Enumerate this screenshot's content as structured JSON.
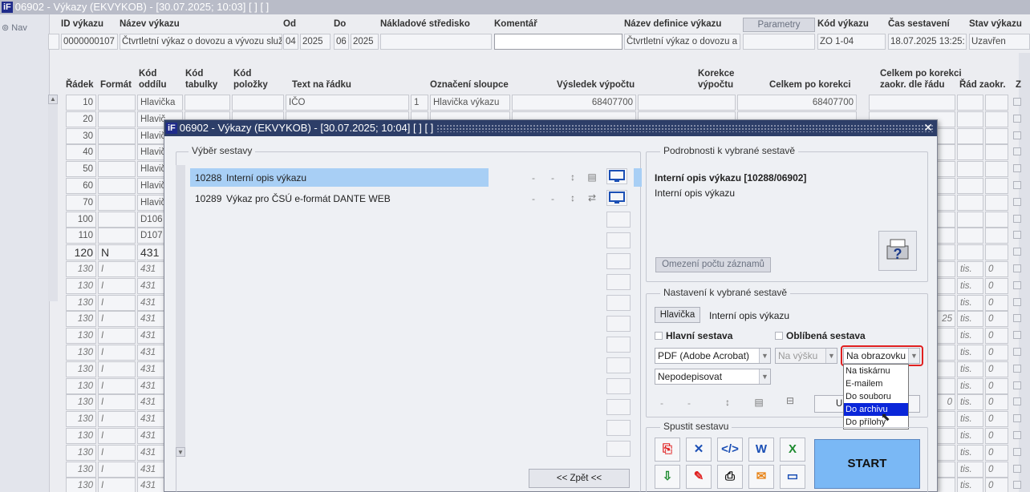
{
  "window": {
    "title": "06902 - Výkazy (EKVYKOB) - [30.07.2025; 10:03]  [ ]  [ ]",
    "logo": "iF"
  },
  "nav": {
    "label": "Nav"
  },
  "header": {
    "labels": {
      "id": "ID výkazu",
      "name": "Název výkazu",
      "od": "Od",
      "do": "Do",
      "center": "Nákladové středisko",
      "comment": "Komentář",
      "defname": "Název definice výkazu",
      "params": "Parametry",
      "code": "Kód výkazu",
      "time": "Čas sestavení",
      "state": "Stav výkazu"
    },
    "values": {
      "id": "0000000107",
      "name": "Čtvrtletní výkaz o dovozu a vývozu služe",
      "od_m": "04",
      "od_y": "2025",
      "do_m": "06",
      "do_y": "2025",
      "center": "",
      "comment": "",
      "defname": "Čtvrtletní výkaz o dovozu a v",
      "params_val": "",
      "code": "ZO 1-04",
      "time": "18.07.2025 13:25:",
      "state": "Uzavřen"
    }
  },
  "table": {
    "headers": {
      "radek": "Řádek",
      "format": "Formát",
      "kod_oddilu_1": "Kód",
      "kod_oddilu_2": "oddílu",
      "kod_tabulky_1": "Kód",
      "kod_tabulky_2": "tabulky",
      "kod_polozky_1": "Kód",
      "kod_polozky_2": "položky",
      "text": "Text na řádku",
      "ozn": "Označení sloupce",
      "vysledek": "Výsledek výpočtu",
      "korekce_1": "Korekce",
      "korekce_2": "výpočtu",
      "celkem": "Celkem po korekci",
      "celkem_zaokr_1": "Celkem po korekci",
      "celkem_zaokr_2": "zaokr. dle řádu",
      "rad": "Řád zaokr.",
      "z": "Z"
    },
    "rows": [
      {
        "radek": "10",
        "format": "",
        "oddil": "Hlavička",
        "text": "IČO",
        "col": "1",
        "ozn": "Hlavička výkazu",
        "vysledek": "68407700",
        "celkem": "68407700"
      },
      {
        "radek": "20",
        "format": "",
        "oddil": "Hlavič",
        "text": "",
        "col": "",
        "ozn": ""
      },
      {
        "radek": "30",
        "format": "",
        "oddil": "Hlavič"
      },
      {
        "radek": "40",
        "format": "",
        "oddil": "Hlavič"
      },
      {
        "radek": "50",
        "format": "",
        "oddil": "Hlavič"
      },
      {
        "radek": "60",
        "format": "",
        "oddil": "Hlavič"
      },
      {
        "radek": "70",
        "format": "",
        "oddil": "Hlavič"
      },
      {
        "radek": "100",
        "format": "",
        "oddil": "D106"
      },
      {
        "radek": "110",
        "format": "",
        "oddil": "D107"
      },
      {
        "radek": "120",
        "format": "N",
        "oddil": "431"
      },
      {
        "radek": "130",
        "format": "I",
        "oddil": "431",
        "rad": "tis.",
        "zaokr": "0"
      },
      {
        "radek": "130",
        "format": "I",
        "oddil": "431",
        "rad": "tis.",
        "zaokr": "0"
      },
      {
        "radek": "130",
        "format": "I",
        "oddil": "431",
        "rad": "tis.",
        "zaokr": "0"
      },
      {
        "radek": "130",
        "format": "I",
        "oddil": "431",
        "rad": "tis.",
        "zaokr": "0",
        "celkem_zaokr": "25"
      },
      {
        "radek": "130",
        "format": "I",
        "oddil": "431",
        "rad": "tis.",
        "zaokr": "0"
      },
      {
        "radek": "130",
        "format": "I",
        "oddil": "431",
        "rad": "tis.",
        "zaokr": "0"
      },
      {
        "radek": "130",
        "format": "I",
        "oddil": "431",
        "rad": "tis.",
        "zaokr": "0"
      },
      {
        "radek": "130",
        "format": "I",
        "oddil": "431",
        "rad": "tis.",
        "zaokr": "0"
      },
      {
        "radek": "130",
        "format": "I",
        "oddil": "431",
        "rad": "tis.",
        "zaokr": "0",
        "celkem_zaokr": "0"
      },
      {
        "radek": "130",
        "format": "I",
        "oddil": "431",
        "rad": "tis.",
        "zaokr": "0"
      },
      {
        "radek": "130",
        "format": "I",
        "oddil": "431",
        "rad": "tis.",
        "zaokr": "0"
      },
      {
        "radek": "130",
        "format": "I",
        "oddil": "431",
        "rad": "tis.",
        "zaokr": "0"
      },
      {
        "radek": "130",
        "format": "I",
        "oddil": "431",
        "rad": "tis.",
        "zaokr": "0"
      },
      {
        "radek": "130",
        "format": "I",
        "oddil": "431",
        "rad": "tis.",
        "zaokr": "0"
      }
    ]
  },
  "dialog": {
    "title": "06902 - Výkazy (EKVYKOB) - [30.07.2025; 10:04]  [ ]  [ ]",
    "select_group": "Výběr sestavy",
    "reports": [
      {
        "id": "10288",
        "name": "Interní opis výkazu",
        "d1": "-",
        "d2": "-"
      },
      {
        "id": "10289",
        "name": "Výkaz pro ČSÚ e-formát DANTE WEB",
        "d1": "-",
        "d2": "-"
      }
    ],
    "back_button": "<< Zpět <<",
    "details_group": "Podrobnosti k vybrané sestavě",
    "details_title": "Interní opis výkazu [10288/06902]",
    "details_sub": "Interní opis výkazu",
    "limit_button": "Omezení počtu záznamů",
    "settings_group": "Nastavení k vybrané sestavě",
    "header_button": "Hlavička",
    "header_value": "Interní opis výkazu",
    "main_report": "Hlavní sestava",
    "fav_report": "Oblíbená sestava",
    "format": "PDF (Adobe Acrobat)",
    "orientation": "Na výšku",
    "output": "Na obrazovku",
    "output_options": [
      "Na tiskárnu",
      "E-mailem",
      "Do souboru",
      "Do archivu",
      "Do přílohy"
    ],
    "output_selected": "Do archivu",
    "sign": "Nepodepisovat",
    "settings_dashes": "-",
    "partial_button": "U",
    "run_group": "Spustit sestavu",
    "start_button": "START"
  }
}
